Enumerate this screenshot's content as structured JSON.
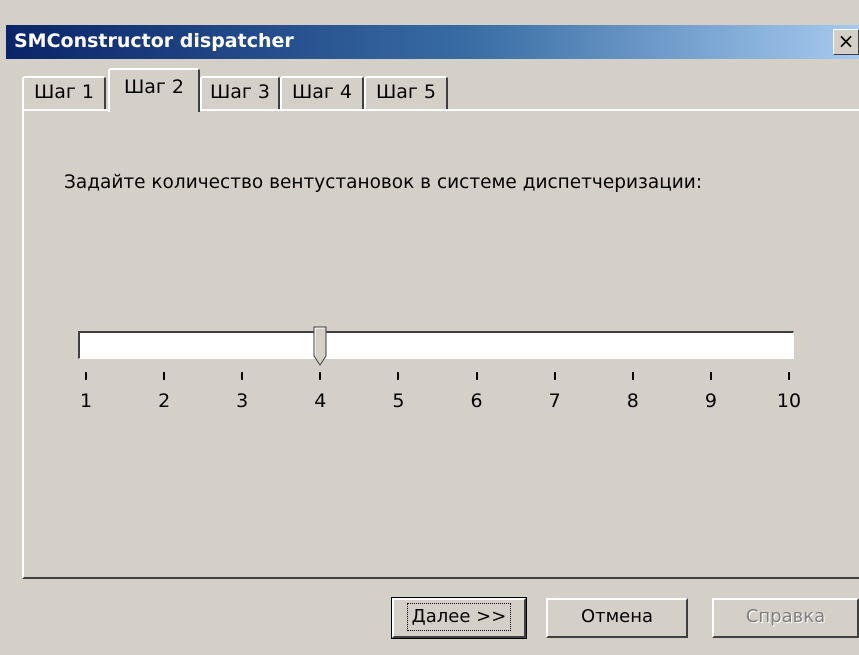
{
  "window": {
    "title": "SMConstructor dispatcher",
    "close_glyph": "×",
    "close_icon": "close-icon"
  },
  "tabs": [
    {
      "label": "Шаг 1",
      "active": false
    },
    {
      "label": "Шаг 2",
      "active": true
    },
    {
      "label": "Шаг 3",
      "active": false
    },
    {
      "label": "Шаг 4",
      "active": false
    },
    {
      "label": "Шаг 5",
      "active": false
    }
  ],
  "step2": {
    "prompt": "Задайте количество вентустановок в системе диспетчеризации:",
    "slider": {
      "min": 1,
      "max": 10,
      "value": 4,
      "tick_labels": [
        "1",
        "2",
        "3",
        "4",
        "5",
        "6",
        "7",
        "8",
        "9",
        "10"
      ]
    }
  },
  "buttons": {
    "next": "Далее >>",
    "cancel": "Отмена",
    "help": "Справка"
  },
  "colors": {
    "face": "#d4d0c8",
    "title_start": "#0a246a",
    "title_end": "#a6caf0",
    "disabled_text": "#808080"
  }
}
